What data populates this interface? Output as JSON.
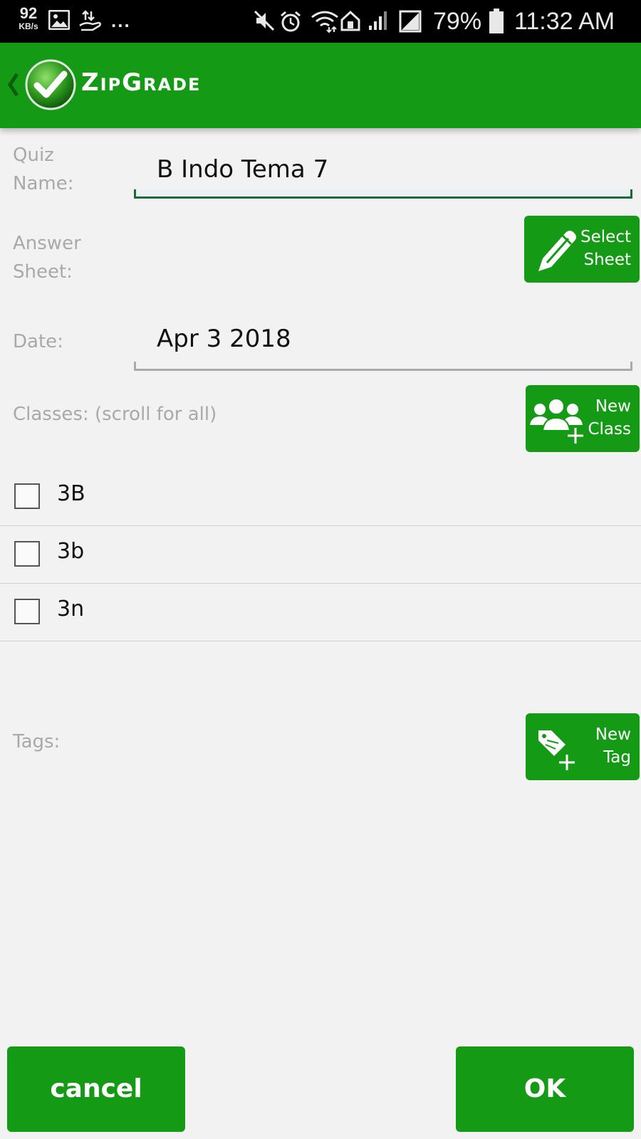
{
  "status_bar": {
    "net_speed_value": "92",
    "net_speed_unit": "KB/s",
    "more_dots": "...",
    "battery_percent": "79%",
    "time": "11:32 AM"
  },
  "app_bar": {
    "title": "ZipGrade"
  },
  "form": {
    "quiz_name_label": "Quiz\nName:",
    "quiz_name_value": "B Indo Tema 7",
    "answer_sheet_label": "Answer\nSheet:",
    "select_sheet_button": "Select\nSheet",
    "date_label": "Date:",
    "date_value": "Apr 3 2018",
    "classes_label": "Classes: (scroll for all)",
    "new_class_button": "New\nClass",
    "classes": [
      {
        "name": "3B",
        "checked": false
      },
      {
        "name": "3b",
        "checked": false
      },
      {
        "name": "3n",
        "checked": false
      }
    ],
    "tags_label": "Tags:",
    "new_tag_button": "New\nTag"
  },
  "actions": {
    "cancel_label": "cancel",
    "ok_label": "OK"
  },
  "colors": {
    "primary_green": "#149a14",
    "background": "#f2f2f2",
    "label_gray": "#a9a9a9"
  }
}
